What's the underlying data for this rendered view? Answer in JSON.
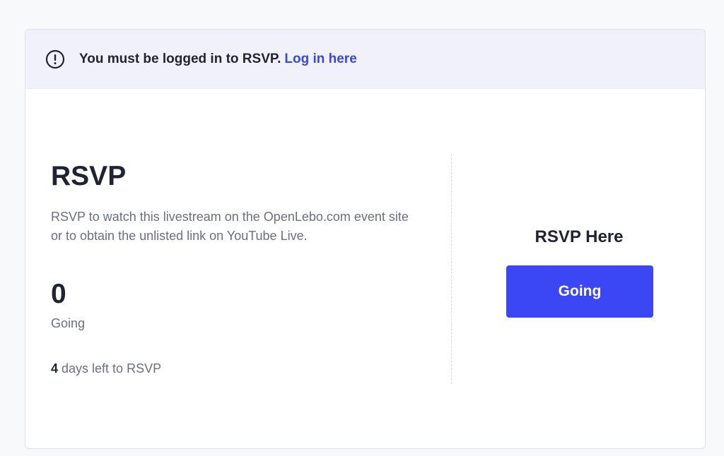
{
  "notice": {
    "icon": "exclamation-circle-icon",
    "message": "You must be logged in to RSVP.",
    "link_label": "Log in here"
  },
  "rsvp": {
    "title": "RSVP",
    "description": "RSVP to watch this livestream on the OpenLebo.com event site or to obtain the unlisted link on YouTube Live.",
    "going_count": "0",
    "going_label": "Going",
    "days_left": "4",
    "days_left_suffix": " days left to RSVP"
  },
  "action": {
    "heading": "RSVP Here",
    "button_label": "Going"
  },
  "colors": {
    "accent": "#3b47f5",
    "link": "#3a47e8",
    "notice_bg": "#f1f1fc"
  }
}
